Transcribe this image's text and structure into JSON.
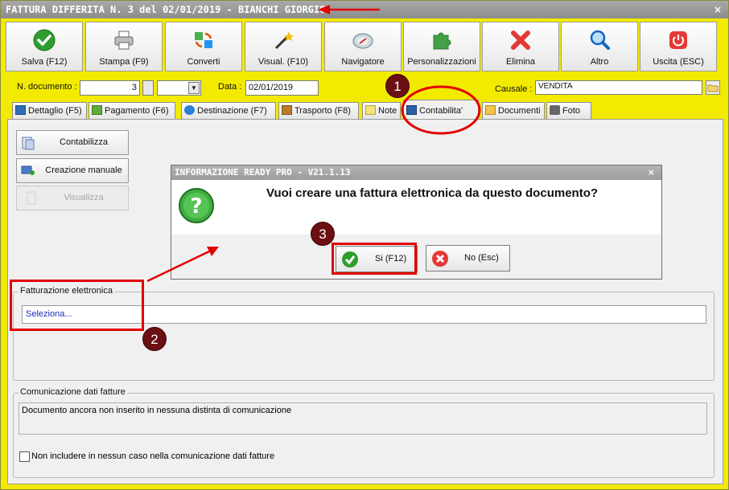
{
  "window": {
    "title": "FATTURA DIFFERITA N. 3 del 02/01/2019 - BIANCHI GIORGIO",
    "close": "×"
  },
  "toolbar": [
    {
      "label": "Salva (F12)",
      "icon": "check-icon"
    },
    {
      "label": "Stampa (F9)",
      "icon": "printer-icon"
    },
    {
      "label": "Converti",
      "icon": "convert-icon"
    },
    {
      "label": "Visual. (F10)",
      "icon": "magic-wand-icon"
    },
    {
      "label": "Navigatore",
      "icon": "compass-icon"
    },
    {
      "label": "Personalizzazioni",
      "icon": "puzzle-icon"
    },
    {
      "label": "Elimina",
      "icon": "delete-icon"
    },
    {
      "label": "Altro",
      "icon": "search-icon"
    },
    {
      "label": "Uscita (ESC)",
      "icon": "power-icon"
    }
  ],
  "header": {
    "doc_label": "N. documento :",
    "doc_number": "3",
    "data_label": "Data :",
    "data_value": "02/01/2019",
    "causale_label": "Causale :",
    "causale_value": "VENDITA"
  },
  "tabs": [
    {
      "label": "Dettaglio (F5)"
    },
    {
      "label": "Pagamento (F6)"
    },
    {
      "label": "Destinazione (F7)"
    },
    {
      "label": "Trasporto (F8)"
    },
    {
      "label": "Note"
    },
    {
      "label": "Contabilita'"
    },
    {
      "label": "Documenti"
    },
    {
      "label": "Foto"
    }
  ],
  "panel": {
    "contabilizza": "Contabilizza",
    "creazione_manuale": "Creazione manuale",
    "visualizza": "Visualizza",
    "fe_group": "Fatturazione elettronica",
    "fe_select": "Seleziona...",
    "cdf_group": "Comunicazione dati fatture",
    "cdf_text": "Documento ancora non inserito in nessuna distinta di comunicazione",
    "cdf_checkbox": "Non includere in nessun caso nella comunicazione dati fatture"
  },
  "dialog": {
    "title": "INFORMAZIONE READY PRO - V21.1.13",
    "close": "×",
    "message": "Vuoi creare una fattura elettronica da questo documento?",
    "yes": "Si (F12)",
    "no": "No (Esc)"
  },
  "annotations": {
    "badge1": "1",
    "badge2": "2",
    "badge3": "3",
    "accent": "#e20000"
  }
}
